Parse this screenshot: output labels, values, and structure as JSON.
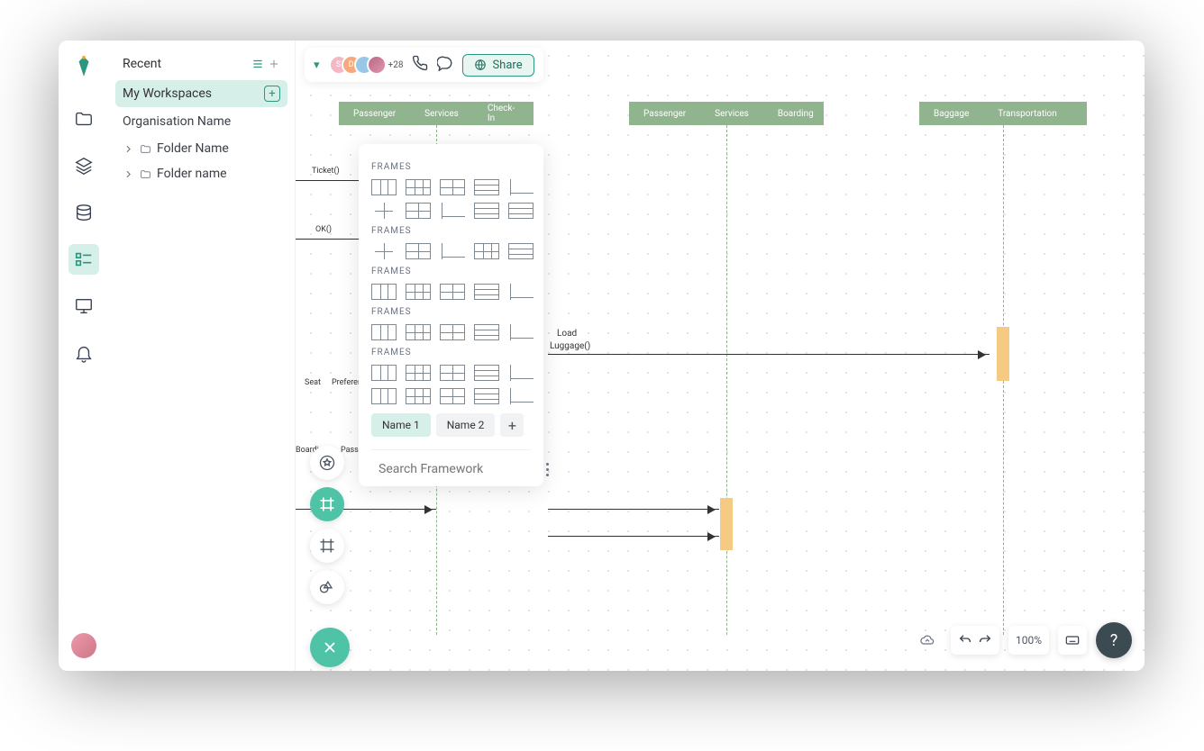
{
  "sidebar": {
    "recent": "Recent",
    "my_workspaces": "My Workspaces",
    "org": "Organisation Name",
    "folders": [
      "Folder Name",
      "Folder name"
    ]
  },
  "topbar": {
    "plus_count": "+28",
    "share": "Share"
  },
  "lanes": {
    "g1": [
      "Passenger",
      "Services",
      "Check-In"
    ],
    "g2": [
      "Passenger",
      "Services",
      "Boarding"
    ],
    "g3": [
      "Baggage",
      "Transportation"
    ]
  },
  "diagram": {
    "ticket": "Ticket()",
    "ok": "OK()",
    "load": "Load",
    "luggage": "Luggage()",
    "seat": "Seat",
    "preferences": "Preferences",
    "boarding": "Boarding",
    "pass": "Pass"
  },
  "framesPanel": {
    "sectionTitle": "FRAMES",
    "tabs": [
      "Name 1",
      "Name 2"
    ],
    "searchPlaceholder": "Search Framework"
  },
  "footer": {
    "zoom": "100%"
  }
}
